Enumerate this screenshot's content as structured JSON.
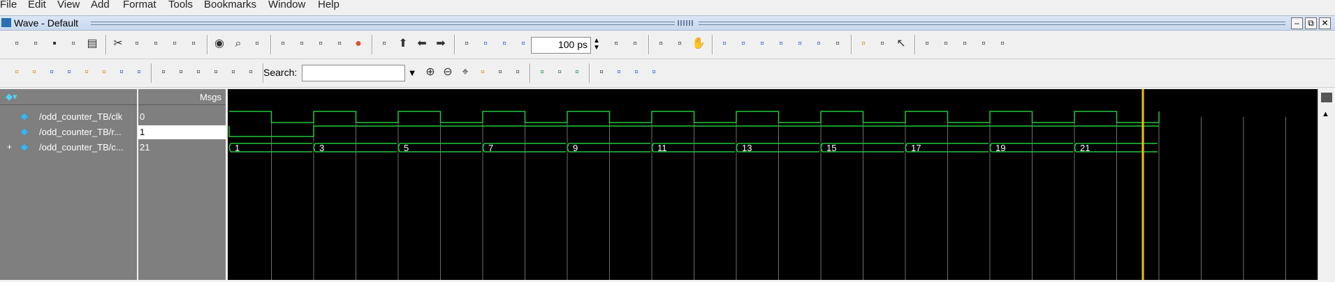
{
  "menu": [
    "File",
    "Edit",
    "View",
    "Add",
    "Format",
    "Tools",
    "Bookmarks",
    "Window",
    "Help"
  ],
  "window": {
    "title": "Wave - Default"
  },
  "toolbar": {
    "time_value": "100 ps",
    "search_label": "Search:",
    "search_value": ""
  },
  "signals": {
    "header_msgs": "Msgs",
    "rows": [
      {
        "name": "/odd_counter_TB/clk",
        "value": "0",
        "expand": ""
      },
      {
        "name": "/odd_counter_TB/r...",
        "value": "1",
        "expand": ""
      },
      {
        "name": "/odd_counter_TB/c...",
        "value": "21",
        "expand": "+"
      }
    ]
  },
  "wave": {
    "bus_labels": [
      "1",
      "3",
      "5",
      "7",
      "9",
      "11",
      "13",
      "15",
      "17",
      "19",
      "21"
    ],
    "colors": {
      "wave": "#22c83c",
      "cursor": "#f2c200",
      "background": "#000000",
      "grid": "#6e6e6e"
    }
  },
  "icons": {
    "toolbar1": [
      "new-file-icon",
      "open-folder-icon",
      "save-icon",
      "reload-icon",
      "print-icon",
      "cut-icon",
      "copy-icon",
      "paste-icon",
      "undo-icon",
      "redo-icon",
      "run-icon",
      "find-icon",
      "format-icon",
      "compile-icon",
      "sim-icon",
      "wave-icon",
      "break-icon",
      "stop-icon",
      "insert-icon",
      "up-icon",
      "back-icon",
      "forward-icon",
      "time-icon",
      "step-icon",
      "step-over-icon",
      "step-out-icon",
      "restart-icon",
      "halt-icon",
      "zoom-full-icon",
      "zoom-window-icon",
      "hand-icon",
      "step-into-icon",
      "cont-icon",
      "step-up-icon",
      "next-edge-icon",
      "prev-edge-icon",
      "first-edge-icon",
      "mem-icon",
      "cursor-icon",
      "probe-icon",
      "select-icon",
      "box-icon",
      "move-icon",
      "measure-icon",
      "list-icon",
      "layout-icon"
    ],
    "toolbar2": [
      "cursor-add-icon",
      "cursor-del-icon",
      "edge-left-icon",
      "edge-right-icon",
      "rise-icon",
      "fall-icon",
      "edge-any-icon",
      "edge-back-icon",
      "find-prev-icon",
      "find-next-icon",
      "find-opt-icon",
      "search-binoculars-icon",
      "search-bin2-icon",
      "search-bin3-icon",
      "zoom-in-icon",
      "zoom-out-icon",
      "zoom-fit-icon",
      "zoom-cursor-icon",
      "zoom-last-icon",
      "zoom-range-icon",
      "marker-icon",
      "block-icon",
      "fill-icon",
      "shade-icon",
      "step-line-icon",
      "step-dot-icon",
      "step-dash-icon"
    ]
  }
}
